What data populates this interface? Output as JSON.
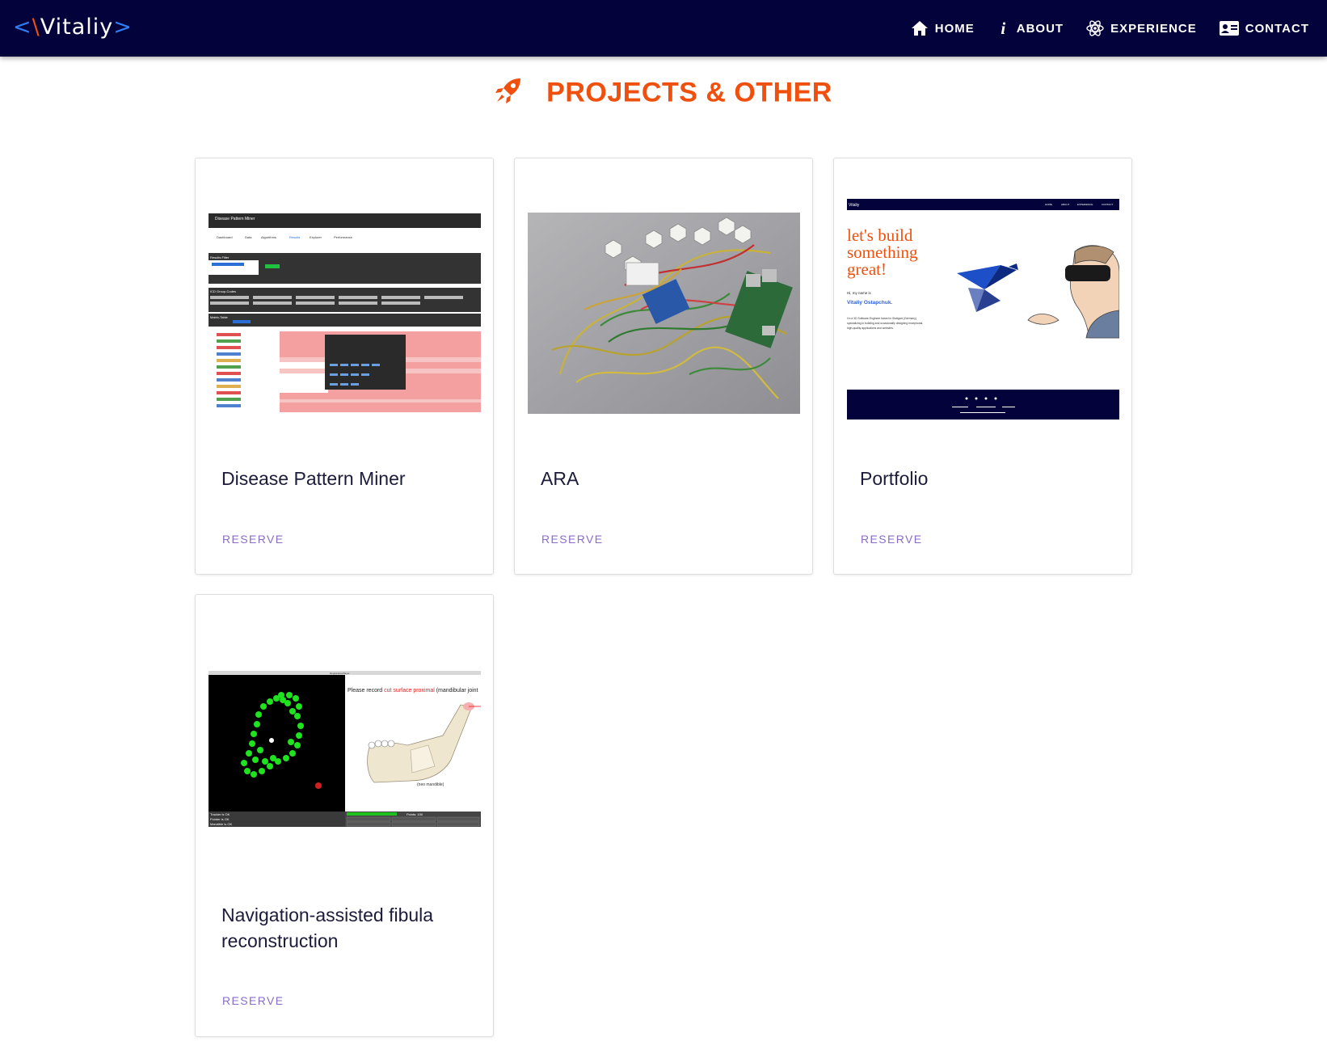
{
  "nav": {
    "brand_lt": "<",
    "brand_slash": "\\",
    "brand_name": "Vitaliy",
    "brand_gt": ">",
    "items": [
      {
        "label": "HOME",
        "icon": "home-icon"
      },
      {
        "label": "ABOUT",
        "icon": "info-icon"
      },
      {
        "label": "EXPERIENCE",
        "icon": "atom-icon"
      },
      {
        "label": "CONTACT",
        "icon": "contact-card-icon"
      }
    ],
    "info_glyph": "i"
  },
  "section": {
    "title": "PROJECTS & OTHER",
    "icon": "rocket-icon"
  },
  "projects": [
    {
      "title": "Disease Pattern Miner",
      "action": "RESERVE",
      "thumbnail": {
        "header": "Disease Pattern Miner",
        "tabs": [
          "Dashboard",
          "Data",
          "Algorithms",
          "Results",
          "Explorer",
          "Performance"
        ],
        "sections": [
          "Results Filter",
          "ICD Group-Codes",
          "Matrix-Table"
        ]
      }
    },
    {
      "title": "ARA",
      "action": "RESERVE"
    },
    {
      "title": "Portfolio",
      "action": "RESERVE",
      "thumbnail": {
        "brand": "Vitaliy",
        "nav": [
          "HOME",
          "ABOUT",
          "EXPERIENCE",
          "CONTACT"
        ],
        "headline": [
          "let's build",
          "something",
          "great!"
        ],
        "greeting": "Hi, my name is",
        "name": "Vitaliy Ostapchuk.",
        "bio": [
          "I'm a 3D Software Engineer based in Stuttgart (Germany)",
          "specializing in building and occasionally designing exceptional,",
          "high-quality applications and websites."
        ]
      }
    },
    {
      "title": "Navigation-assisted fibula reconstruction",
      "action": "RESERVE",
      "thumbnail": {
        "window_title": "RegistrationPlayer",
        "instruction_prefix": "Please record ",
        "instruction_highlight": "cut surface proximal",
        "instruction_suffix": " (mandibular joint",
        "caption": "(neo mandible)",
        "status": [
          "Tracker is OK",
          "Pointer is OK",
          "Mandible is OK"
        ],
        "readout": "Points: 100"
      }
    }
  ],
  "colors": {
    "navbar_bg": "#03023a",
    "accent_orange": "#f0500e",
    "accent_blue": "#2f7df6",
    "reserve_purple": "#8a6cc8",
    "title_text": "#1b1b3a"
  }
}
